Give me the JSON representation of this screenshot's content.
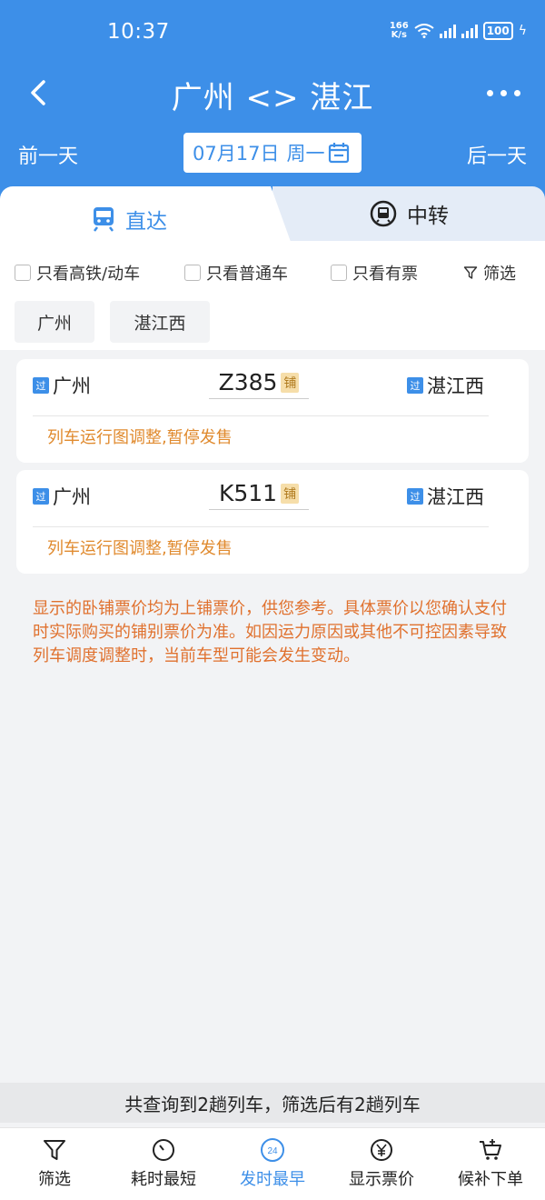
{
  "status_bar": {
    "time": "10:37",
    "speed_top": "166",
    "speed_unit": "K/s",
    "battery": "100"
  },
  "header": {
    "title": "广州 <> 湛江",
    "prev_day": "前一天",
    "next_day": "后一天",
    "date": "07月17日",
    "weekday": "周一"
  },
  "tabs": {
    "direct": "直达",
    "transfer": "中转"
  },
  "filters": {
    "high_speed": "只看高铁/动车",
    "normal": "只看普通车",
    "available": "只看有票",
    "screen": "筛选"
  },
  "stations": {
    "from": "广州",
    "to": "湛江西"
  },
  "trains": [
    {
      "from": "广州",
      "train_no": "Z385",
      "sleeper": "铺",
      "to": "湛江西",
      "pass_badge": "过",
      "note": "列车运行图调整,暂停发售"
    },
    {
      "from": "广州",
      "train_no": "K511",
      "sleeper": "铺",
      "to": "湛江西",
      "pass_badge": "过",
      "note": "列车运行图调整,暂停发售"
    }
  ],
  "notice": "显示的卧铺票价均为上铺票价，供您参考。具体票价以您确认支付时实际购买的铺别票价为准。如因运力原因或其他不可控因素导致列车调度调整时，当前车型可能会发生变动。",
  "summary": "共查询到2趟列车，筛选后有2趟列车",
  "bottom_nav": {
    "filter": "筛选",
    "shortest": "耗时最短",
    "earliest": "发时最早",
    "earliest_icon_text": "24",
    "price": "显示票价",
    "waitlist": "候补下单"
  },
  "colors": {
    "brand_blue": "#3d8fe8",
    "notice_orange": "#e0712e"
  }
}
